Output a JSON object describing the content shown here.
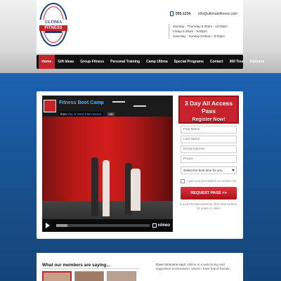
{
  "header": {
    "logo_alt": "Ultimate Convent...",
    "phone": "555-1234",
    "email": "info@ultimatefitness.com",
    "hours": [
      "Monday - Thursday 5:30am - 10:00pm",
      "Friday 5:30am - 9:00pm",
      "Saturday - Sunday 8:00am - 8:00pm"
    ]
  },
  "nav": {
    "items": [
      "Home",
      "Gift Ideas",
      "Group Fitness",
      "Personal Training",
      "Camp Ultima",
      "Special Programs",
      "Contact",
      "360 Tour",
      "Partners"
    ],
    "active_index": 0
  },
  "video": {
    "title": "Fitness Boot Camp",
    "from_prefix": "from",
    "channel": "City of West Palm Beach",
    "hd_label": "HD",
    "brand": "vimeo",
    "progress": 0.12
  },
  "form": {
    "title": "3 Day All Access Pass",
    "subtitle": "Register Now!",
    "fields": {
      "first_name": "First Name",
      "last_name": "Last Name",
      "email": "Email Address",
      "phone": "Phone"
    },
    "select_value": "Select the best time for you",
    "consent_text": "I give you permission to contact me",
    "submit_label": "REQUEST PASS >>",
    "disclaimer": "*Local Florida residents, first time visitors, 18 years or older."
  },
  "testimonials": {
    "title": "What our members are saying...",
    "quote_name": "Dave Simmons says:",
    "quote_text": "Ultima is a welcoming and supportive environment, where I have found friends..."
  },
  "colors": {
    "brand_red": "#c8232c",
    "brand_navy": "#1b3f7c",
    "nav_bg": "#111111",
    "page_blue": "#1c63b2"
  }
}
